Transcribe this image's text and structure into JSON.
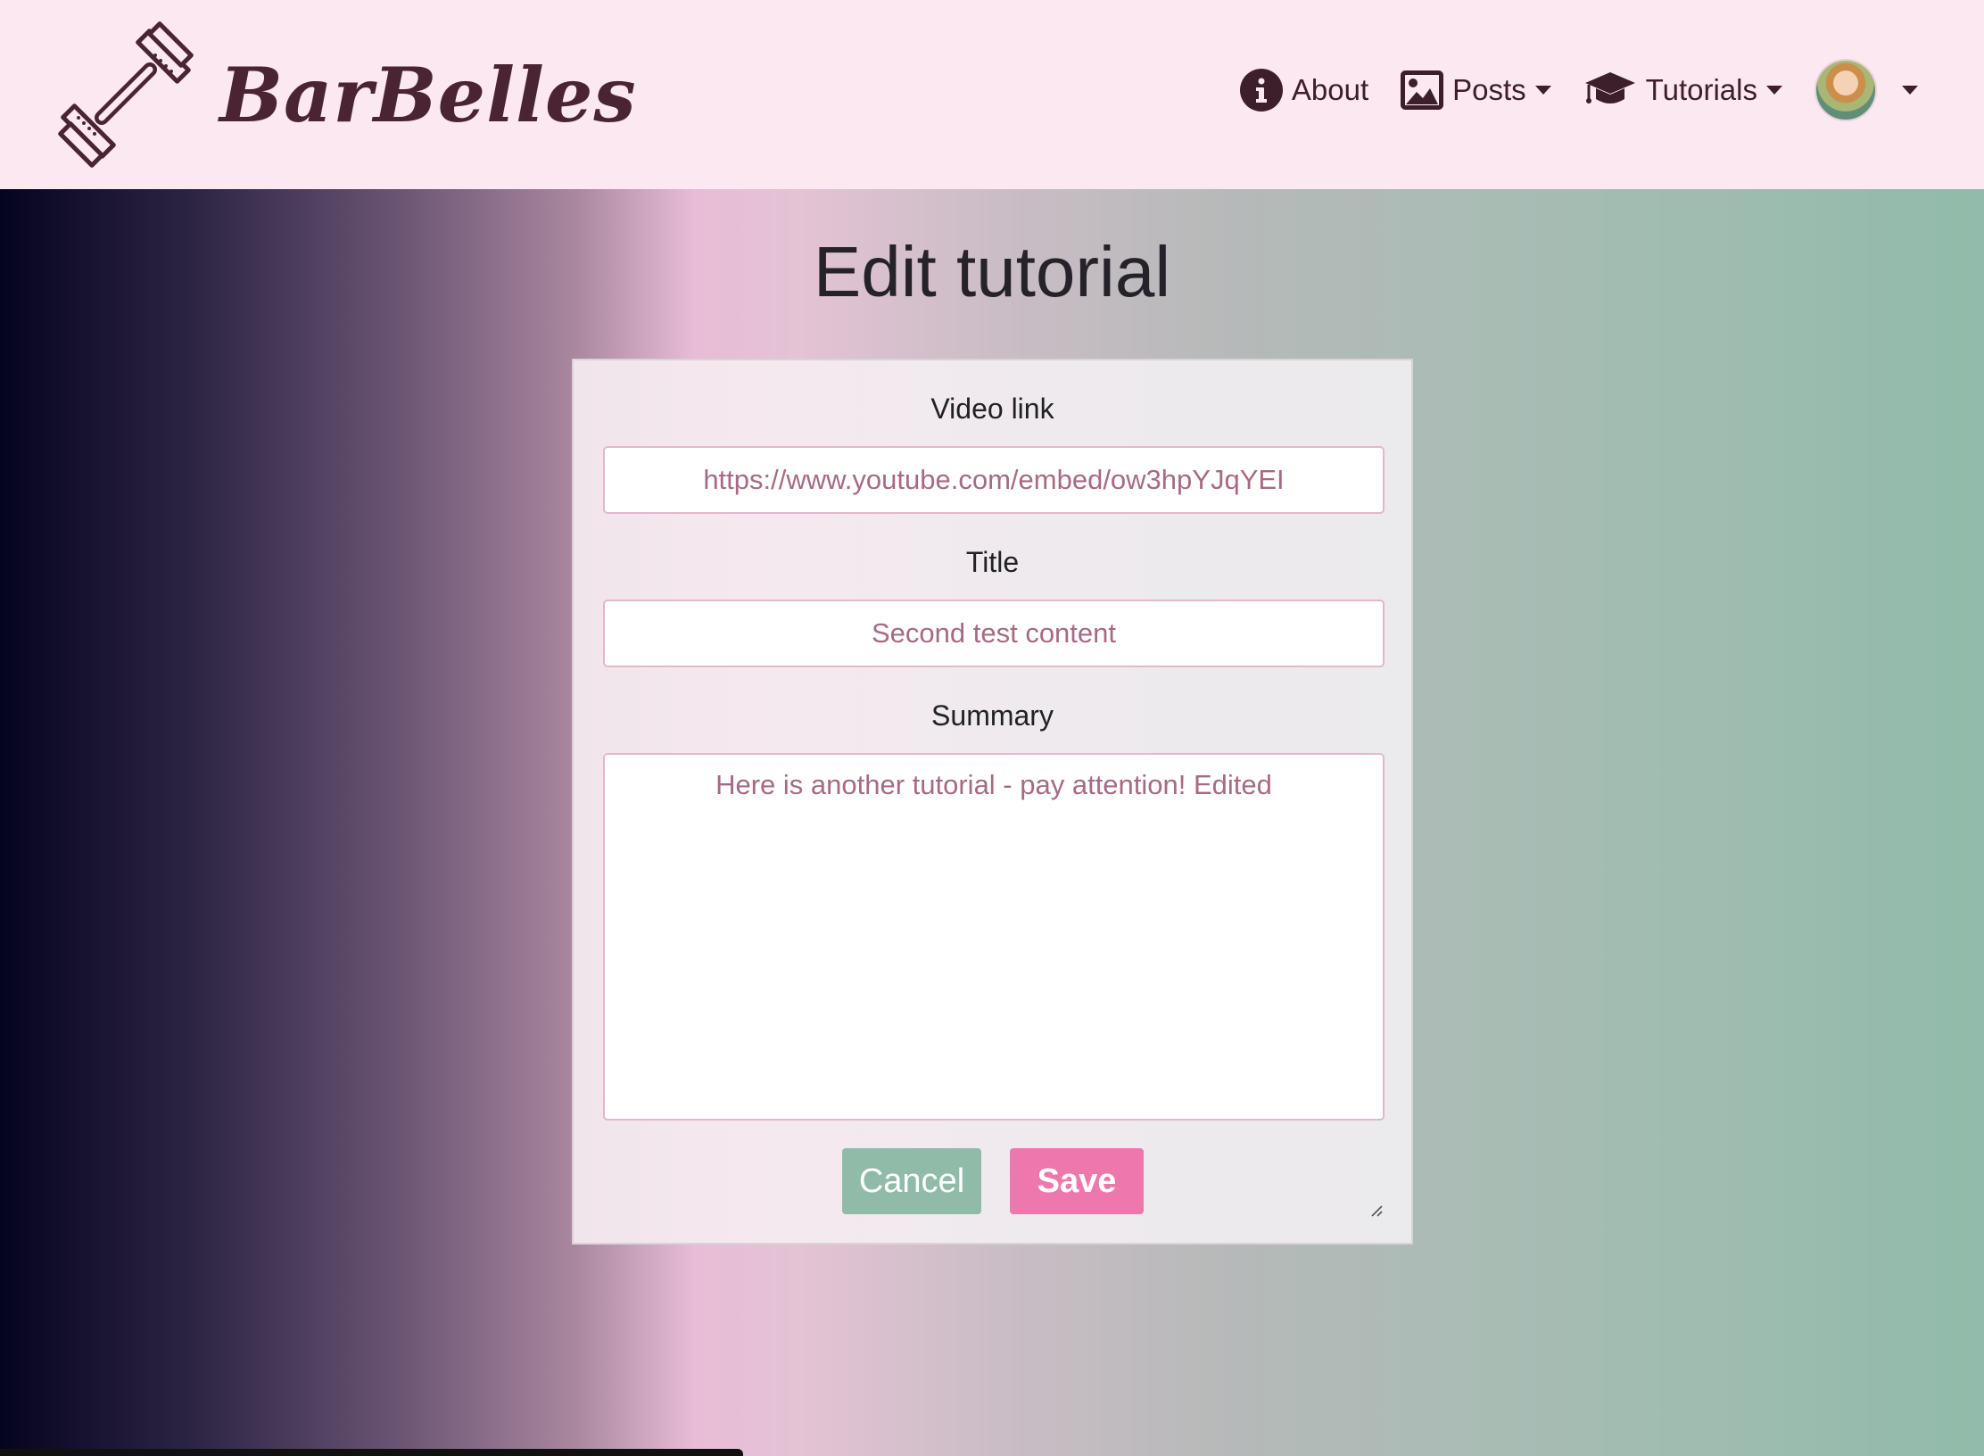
{
  "app": {
    "brand_name": "BarBelles",
    "logo_icon": "barbell-icon"
  },
  "nav": {
    "about_label": "About",
    "about_icon": "info-icon",
    "posts_label": "Posts",
    "posts_icon": "image-icon",
    "tutorials_label": "Tutorials",
    "tutorials_icon": "graduation-cap-icon",
    "profile_icon": "avatar"
  },
  "page": {
    "title": "Edit tutorial"
  },
  "form": {
    "video_link": {
      "label": "Video link",
      "value": "https://www.youtube.com/embed/ow3hpYJqYEI"
    },
    "title": {
      "label": "Title",
      "value": "Second test content"
    },
    "summary": {
      "label": "Summary",
      "value": "Here is another tutorial - pay attention! Edited"
    },
    "cancel_label": "Cancel",
    "save_label": "Save"
  },
  "colors": {
    "navbar_bg": "#fbe8f1",
    "brand_text": "#4a2433",
    "input_text": "#a66a86",
    "cancel_bg": "#91bba9",
    "save_bg": "#ee77ad"
  }
}
